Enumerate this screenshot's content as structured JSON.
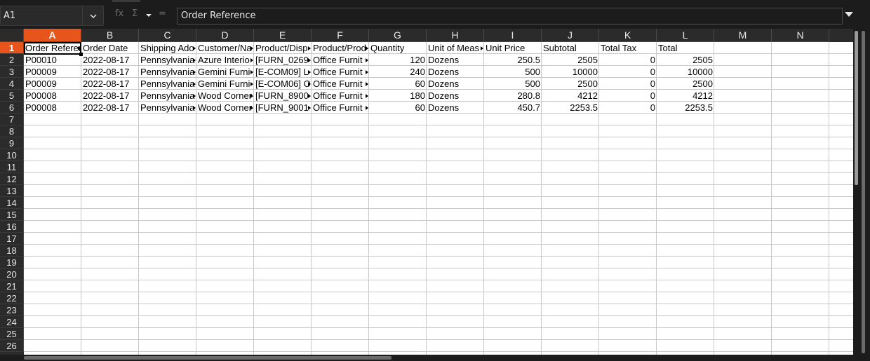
{
  "formula_bar": {
    "name_box": "A1",
    "function_wizard_icon": "fx",
    "sum_icon": "Σ",
    "equals_icon": "=",
    "formula_text": "Order Reference"
  },
  "columns": [
    "A",
    "B",
    "C",
    "D",
    "E",
    "F",
    "G",
    "H",
    "I",
    "J",
    "K",
    "L",
    "M",
    "N"
  ],
  "rows": [
    "1",
    "2",
    "3",
    "4",
    "5",
    "6",
    "7",
    "8",
    "9",
    "10",
    "11",
    "12",
    "13",
    "14",
    "15",
    "16",
    "17",
    "18",
    "19",
    "20",
    "21",
    "22",
    "23",
    "24",
    "25",
    "26"
  ],
  "active_cell": "A1",
  "table": {
    "headers": [
      "Order Referer",
      "Order Date",
      "Shipping Ado",
      "Customer/Na",
      "Product/Disp",
      "Product/Prod",
      "Quantity",
      "Unit of Meas",
      "Unit Price",
      "Subtotal",
      "Total Tax",
      "Total"
    ],
    "data": [
      [
        "P00010",
        "2022-08-17",
        "Pennsylvania",
        "Azure Interio",
        "[FURN_0269",
        "Office Furnit",
        "120",
        "Dozens",
        "250.5",
        "2505",
        "0",
        "2505"
      ],
      [
        "P00009",
        "2022-08-17",
        "Pennsylvania",
        "Gemini Furni",
        "[E-COM09] L",
        "Office Furnit",
        "240",
        "Dozens",
        "500",
        "10000",
        "0",
        "10000"
      ],
      [
        "P00009",
        "2022-08-17",
        "Pennsylvania",
        "Gemini Furni",
        "[E-COM06] O",
        "Office Furnit",
        "60",
        "Dozens",
        "500",
        "2500",
        "0",
        "2500"
      ],
      [
        "P00008",
        "2022-08-17",
        "Pennsylvania",
        "Wood Corner",
        "[FURN_8900",
        "Office Furnit",
        "180",
        "Dozens",
        "280.8",
        "4212",
        "0",
        "4212"
      ],
      [
        "P00008",
        "2022-08-17",
        "Pennsylvania",
        "Wood Corner",
        "[FURN_9001",
        "Office Furnit",
        "60",
        "Dozens",
        "450.7",
        "2253.5",
        "0",
        "2253.5"
      ]
    ]
  },
  "colors": {
    "accent": "#e8551c",
    "header_bg": "#2b2b2b",
    "grid_line": "#c8c8c8"
  }
}
